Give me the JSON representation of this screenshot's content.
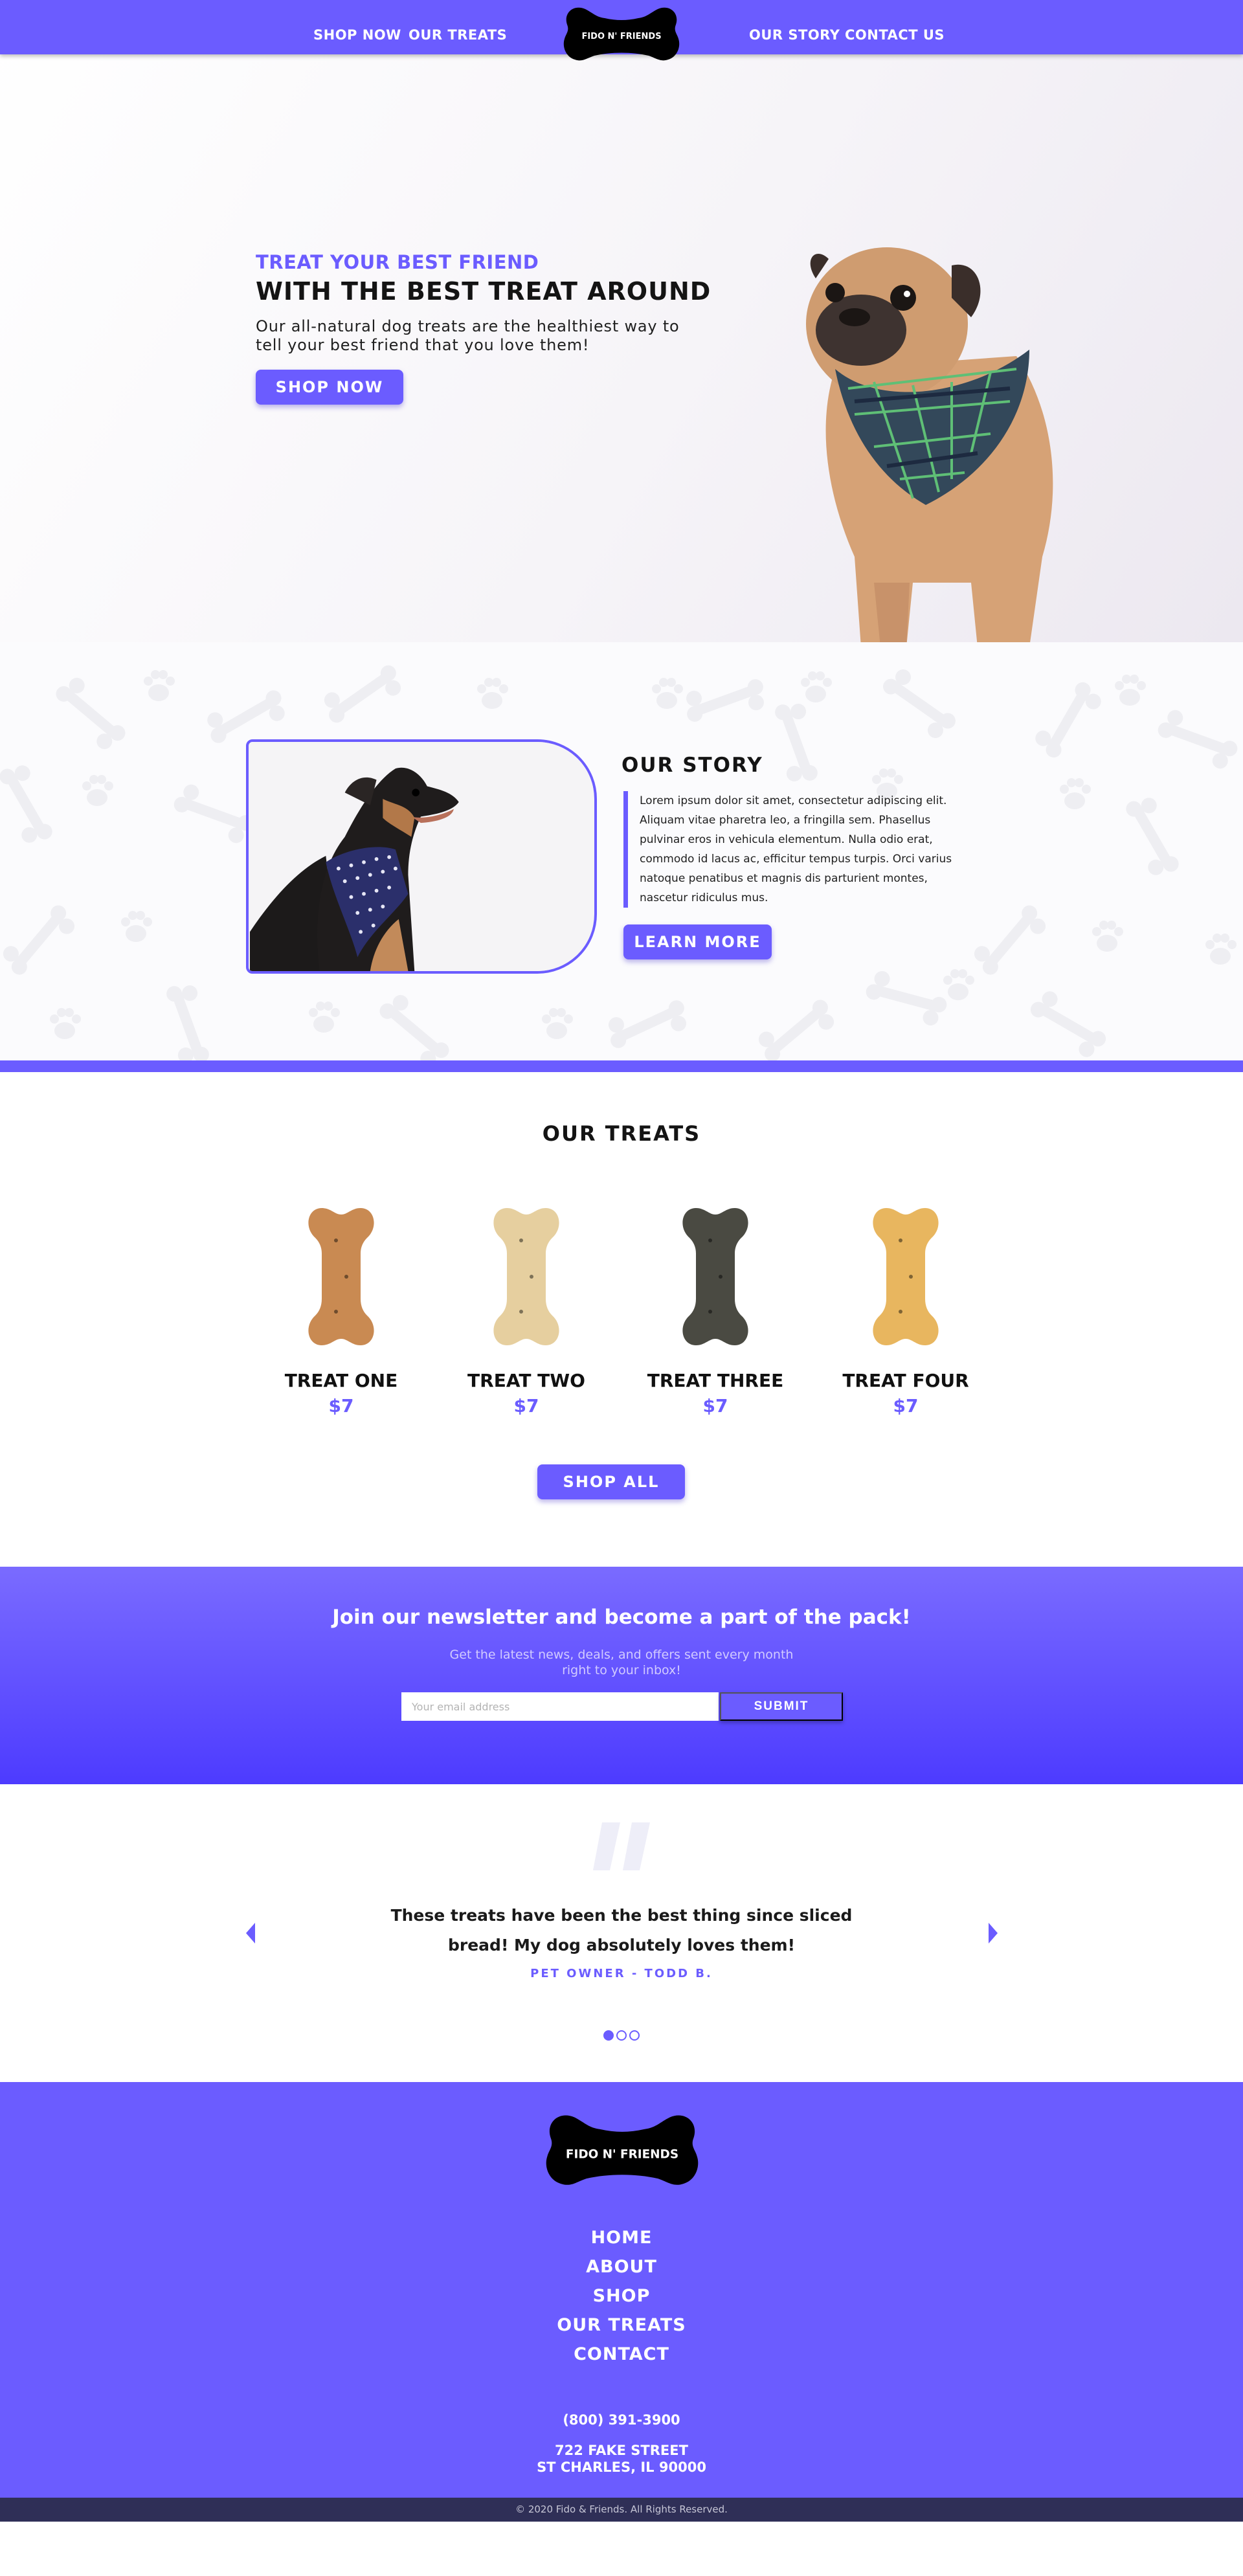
{
  "nav": {
    "links": [
      "SHOP NOW",
      "OUR TREATS",
      "OUR STORY",
      "CONTACT US"
    ],
    "logo_text": "FIDO N' FRIENDS"
  },
  "hero": {
    "subtitle": "TREAT YOUR BEST FRIEND",
    "title": "WITH THE BEST TREAT AROUND",
    "text": "Our all-natural dog treats are the healthiest way to tell your best friend that you love them!",
    "button": "SHOP NOW"
  },
  "story": {
    "title": "OUR STORY",
    "text": "Lorem ipsum dolor sit amet, consectetur adipiscing elit. Aliquam vitae pharetra leo, a fringilla sem. Phasellus pulvinar eros in vehicula elementum. Nulla odio erat, commodo id lacus ac, efficitur tempus turpis. Orci varius natoque penatibus et magnis dis parturient montes, nascetur ridiculus mus.",
    "button": "LEARN MORE"
  },
  "treats": {
    "title": "OUR TREATS",
    "items": [
      {
        "name": "TREAT ONE",
        "price": "$7",
        "color": "#c98a52"
      },
      {
        "name": "TREAT TWO",
        "price": "$7",
        "color": "#e6cf9f"
      },
      {
        "name": "TREAT THREE",
        "price": "$7",
        "color": "#4a4a42"
      },
      {
        "name": "TREAT FOUR",
        "price": "$7",
        "color": "#e8b65f"
      }
    ],
    "button": "SHOP ALL"
  },
  "newsletter": {
    "title": "Join our newsletter and become a part of the pack!",
    "subtitle_line1": "Get the latest news, deals, and offers sent every month",
    "subtitle_line2": "right to your inbox!",
    "placeholder": "Your email address",
    "button": "SUBMIT"
  },
  "testimonial": {
    "text": "These treats have been the best thing since sliced bread! My dog absolutely loves them!",
    "author": "PET OWNER - TODD B.",
    "active_slide": 1,
    "slide_count": 3
  },
  "footer": {
    "logo_text": "FIDO N' FRIENDS",
    "links": [
      "HOME",
      "ABOUT",
      "SHOP",
      "OUR TREATS",
      "CONTACT"
    ],
    "phone": "(800) 391-3900",
    "address_line1": "722 FAKE STREET",
    "address_line2": "ST CHARLES, IL 90000",
    "copyright": "© 2020 Fido & Friends. All Rights Reserved."
  },
  "colors": {
    "accent": "#6b5cff",
    "footer_bar": "#2f2f57",
    "newsletter_top": "#7a6bff",
    "newsletter_bottom": "#4d3bff"
  },
  "icons": [
    "bone-logo-icon",
    "chevron-down-icon",
    "quote-icon",
    "arrow-left-icon",
    "arrow-right-icon",
    "bone-icon",
    "paw-icon"
  ]
}
